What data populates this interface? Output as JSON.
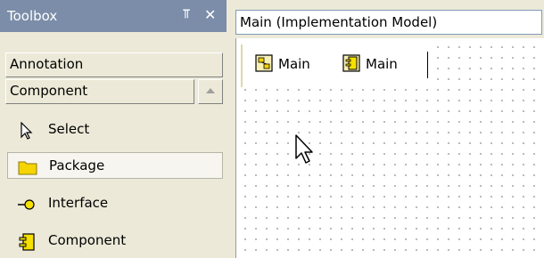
{
  "toolbox": {
    "title": "Toolbox",
    "pin_icon": "pin-icon",
    "close_icon": "close-icon",
    "categories": [
      {
        "label": "Annotation"
      },
      {
        "label": "Component"
      }
    ],
    "tools": [
      {
        "label": "Select",
        "icon": "arrow-pointer-icon"
      },
      {
        "label": "Package",
        "icon": "folder-icon"
      },
      {
        "label": "Interface",
        "icon": "lollipop-interface-icon"
      },
      {
        "label": "Component",
        "icon": "component-icon"
      }
    ]
  },
  "editor": {
    "title": "Main (Implementation Model)",
    "tabs": [
      {
        "label": "Main",
        "icon": "diagram-icon"
      },
      {
        "label": "Main",
        "icon": "component-diagram-icon"
      }
    ]
  },
  "colors": {
    "toolbox_header_bg": "#7b8da8",
    "panel_bg": "#ece9d8",
    "folder": "#f5d400",
    "canvas_dot": "#b4b4b4"
  }
}
